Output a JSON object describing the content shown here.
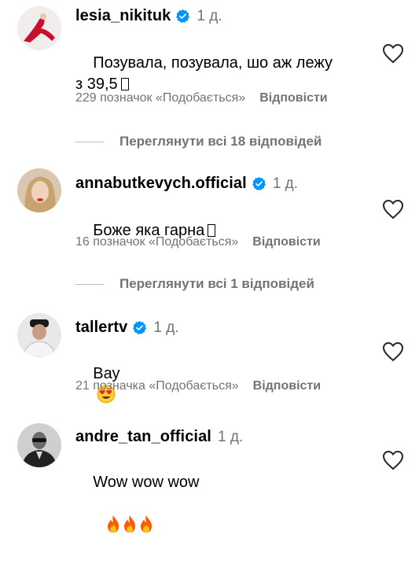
{
  "comments": [
    {
      "username": "lesia_nikituk",
      "time": "1 д.",
      "text": "Позувала, позувала, шо аж лежу з 39,5",
      "glyph": "square-glyph",
      "likes": "229 позначок «Подобається»",
      "reply": "Відповісти",
      "view_replies": "Переглянути всі 18 відповідей"
    },
    {
      "username": "annabutkevych.official",
      "time": "1 д.",
      "text": "Боже яка гарна",
      "glyph": "square-glyph",
      "likes": "16 позначок «Подобається»",
      "reply": "Відповісти",
      "view_replies": "Переглянути всі 1 відповідей"
    },
    {
      "username": "tallertv",
      "time": "1 д.",
      "text": "Вау",
      "glyph": "heart-eyes-emoji",
      "likes": "21 позначка «Подобається»",
      "reply": "Відповісти"
    },
    {
      "username": "andre_tan_official",
      "time": "1 д.",
      "text": "Wow wow wow",
      "glyph": "fire-emoji x3"
    }
  ],
  "colors": {
    "verified": "#0095f6",
    "secondary_text": "#737373",
    "fire": "#ff7a00"
  }
}
